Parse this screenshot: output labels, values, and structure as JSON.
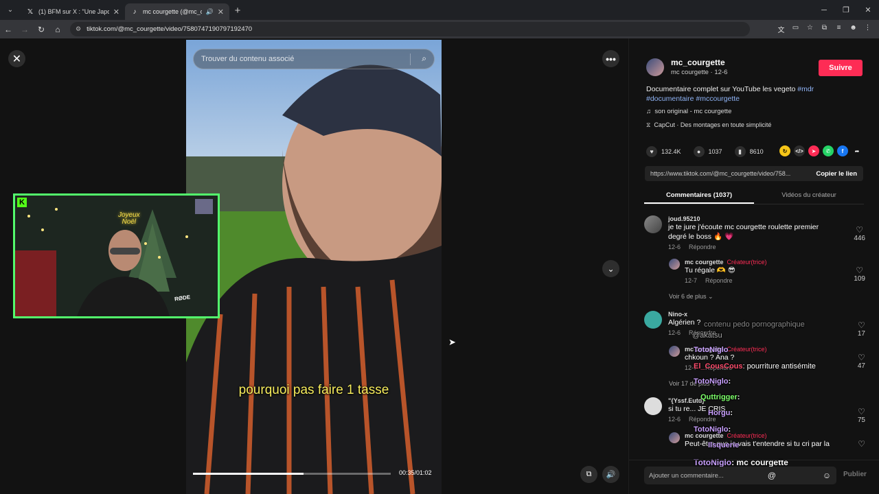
{
  "browser": {
    "tabs": [
      {
        "title": "(1) BFM sur X : \"Une Japonaise",
        "icon": "x-logo-icon"
      },
      {
        "title": "mc courgette (@mc_courgette",
        "icon": "tiktok-icon"
      }
    ],
    "url": "tiktok.com/@mc_courgette/video/7580747190797192470"
  },
  "video": {
    "search_placeholder": "Trouver du contenu associé",
    "caption": "pourquoi pas faire 1 tasse",
    "time": "00:35/01:02",
    "progress": 0.56
  },
  "webcam": {
    "neon_line1": "Joyeux",
    "neon_line2": "Noël",
    "mic_brand": "RØDE"
  },
  "post": {
    "username": "mc_courgette",
    "subline": "mc courgette · 12-6",
    "follow_label": "Suivre",
    "desc_text": "Documentaire complet sur YouTube les vegeto",
    "tag1": "#mdr",
    "tag2": "#documentaire",
    "tag3": "#mccourgette",
    "music": "son original - mc courgette",
    "capcut": "CapCut · Des montages en toute simplicité",
    "likes": "132.4K",
    "comments_count": "1037",
    "saves": "8610",
    "link": "https://www.tiktok.com/@mc_courgette/video/758...",
    "copy_label": "Copier le lien"
  },
  "panel_tabs": {
    "comments": "Commentaires (1037)",
    "creator_videos": "Vidéos du créateur"
  },
  "comments": [
    {
      "user": "joud.95210",
      "text1": "je te jure j'écoute mc courgette roulette premier",
      "text2": "degré le boss 🔥 💗",
      "date": "12-6",
      "reply": "Répondre",
      "likes": "446"
    },
    {
      "user": "mc courgette",
      "creator": "Créateur(trice)",
      "text": "Tu régale 🫶 😎",
      "date": "12-7",
      "reply": "Répondre",
      "likes": "109"
    },
    {
      "more": "Voir 6 de plus"
    },
    {
      "user": "Nino-x",
      "text": "Algérien ?",
      "date": "12-6",
      "reply": "Répondre",
      "likes": "17"
    },
    {
      "user": "mc courgette",
      "creator": "Créateur(trice)",
      "text": "chkoun ? Ana ?",
      "date": "12-7",
      "reply": "Répondre",
      "likes": "47"
    },
    {
      "more": "Voir 17 de plus"
    },
    {
      "user": "\"{Yssf.Eutd}",
      "text": "si tu re... JE CRIS",
      "date": "12-6",
      "reply": "Répondre",
      "likes": "75"
    },
    {
      "user": "mc courgette",
      "creator": "Créateur(trice)",
      "text": "Peut-être que je vais t'entendre si tu cri par la"
    }
  ],
  "chat_overlay": [
    {
      "user": "",
      "msg": "contenu pedo pornographique"
    },
    {
      "user": "",
      "msg": "@akatsu"
    },
    {
      "user": "TotoNiglo",
      "msg": ""
    },
    {
      "user": "El_CousCous",
      "msg": ": pourriture antisémite"
    },
    {
      "user": "TotoNiglo",
      "msg": ":"
    },
    {
      "user": "Quttrigger",
      "msg": ":"
    },
    {
      "user": "Horgu",
      "msg": ":"
    },
    {
      "user": "TotoNiglo",
      "msg": ":"
    },
    {
      "user": "Ilsquerie",
      "msg": ""
    },
    {
      "user": "TotoNiglo",
      "msg": ": mc courgette"
    }
  ],
  "add_comment": {
    "placeholder": "Ajouter un commentaire...",
    "publish": "Publier"
  }
}
